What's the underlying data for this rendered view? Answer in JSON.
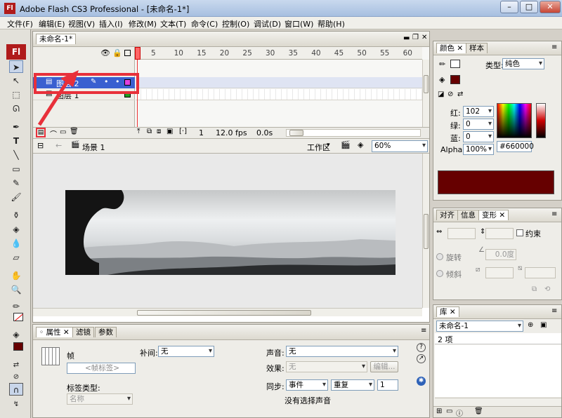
{
  "window": {
    "title": "Adobe Flash CS3 Professional - [未命名-1*]",
    "app_icon": "Fl",
    "minimize": "–",
    "maximize": "□",
    "close": "✕"
  },
  "menu": [
    "文件(F)",
    "编辑(E)",
    "视图(V)",
    "插入(I)",
    "修改(M)",
    "文本(T)",
    "命令(C)",
    "控制(O)",
    "调试(D)",
    "窗口(W)",
    "帮助(H)"
  ],
  "document_tab": "未命名-1*",
  "timeline": {
    "frame_numbers": [
      "5",
      "10",
      "15",
      "20",
      "25",
      "30",
      "35",
      "40",
      "45",
      "50",
      "55",
      "60",
      "65"
    ],
    "layers": [
      {
        "name": "图层 2",
        "selected": true,
        "outline_color": "#e040e0"
      },
      {
        "name": "图层 1",
        "selected": false,
        "outline_color": "#20a020"
      }
    ],
    "status": {
      "frame": "1",
      "fps": "12.0 fps",
      "time": "0.0s"
    }
  },
  "editbar": {
    "scene": "场景 1",
    "workspace": "工作区",
    "zoom": "60%"
  },
  "properties_panel": {
    "tabs": [
      "属性",
      "滤镜",
      "参数"
    ],
    "frame_label": "帧",
    "frame_name_placeholder": "<帧标签>",
    "label_type_label": "标签类型:",
    "label_type_value": "名称",
    "tween_label": "补间:",
    "tween_value": "无",
    "sound_label": "声音:",
    "sound_value": "无",
    "effect_label": "效果:",
    "effect_value": "无",
    "edit_button": "编辑...",
    "sync_label": "同步:",
    "sync_value": "事件",
    "repeat_value": "重复",
    "repeat_count": "1",
    "no_sound": "没有选择声音"
  },
  "color_panel": {
    "tabs": [
      "颜色",
      "样本"
    ],
    "type_label": "类型:",
    "type_value": "纯色",
    "red_label": "红:",
    "red": "102",
    "green_label": "绿:",
    "green": "0",
    "blue_label": "蓝:",
    "blue": "0",
    "alpha_label": "Alpha:",
    "alpha": "100%",
    "hex": "#660000",
    "fill_color": "#660000"
  },
  "transform_panel": {
    "tabs": [
      "对齐",
      "信息",
      "变形"
    ],
    "constrain": "约束",
    "rotate": "旋转",
    "rotate_value": "0.0度",
    "skew": "倾斜"
  },
  "library_panel": {
    "tab": "库",
    "document": "未命名-1",
    "item_count": "2 项"
  }
}
